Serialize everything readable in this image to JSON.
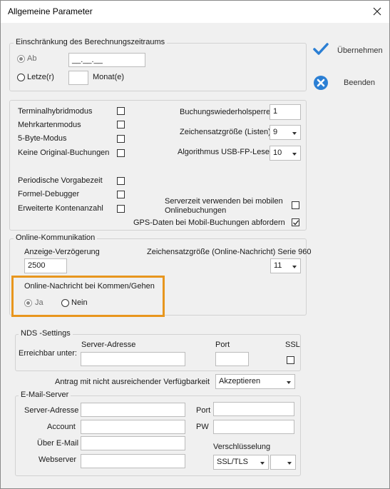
{
  "window": {
    "title": "Allgemeine Parameter"
  },
  "side_buttons": {
    "accept_label": "Übernehmen",
    "quit_label": "Beenden"
  },
  "period": {
    "legend": "Einschränkung des Berechnungszeitraums",
    "from_label": "Ab",
    "from_value": "__.__.__",
    "last_label": "Letze(r)",
    "last_value": "",
    "month_label": "Monat(e)"
  },
  "options": {
    "left_items": [
      {
        "label": "Terminalhybridmodus",
        "checked": false
      },
      {
        "label": "Mehrkartenmodus",
        "checked": false
      },
      {
        "label": "5-Byte-Modus",
        "checked": false
      },
      {
        "label": "Keine Original-Buchungen",
        "checked": false
      },
      {
        "label": "Periodische Vorgabezeit",
        "checked": false
      },
      {
        "label": "Formel-Debugger",
        "checked": false
      },
      {
        "label": "Erweiterte Kontenanzahl",
        "checked": false
      }
    ],
    "booking_repeat_label": "Buchungswiederholsperre",
    "booking_repeat_value": "1",
    "charsize_lists_label": "Zeichensatzgröße (Listen)",
    "charsize_lists_value": "9",
    "algorithm_label": "Algorithmus USB-FP-Leser",
    "algorithm_value": "10",
    "server_time_label_1": "Serverzeit verwenden bei mobilen",
    "server_time_label_2": "Onlinebuchungen",
    "server_time_checked": false,
    "gps_label": "GPS-Daten bei Mobil-Buchungen abfordern",
    "gps_checked": true
  },
  "online": {
    "legend": "Online-Kommunikation",
    "delay_label": "Anzeige-Verzögerung",
    "delay_value": "2500",
    "charsize_label": "Zeichensatzgröße (Online-Nachricht) Serie 960",
    "charsize_value": "11",
    "message_legend": "Online-Nachricht bei Kommen/Gehen",
    "yes_label": "Ja",
    "no_label": "Nein"
  },
  "nds": {
    "legend": "NDS -Settings",
    "reachable_label": "Erreichbar unter:",
    "server_label": "Server-Adresse",
    "server_value": "",
    "port_label": "Port",
    "port_value": "",
    "ssl_label": "SSL",
    "ssl_checked": false
  },
  "availability": {
    "label": "Antrag mit nicht ausreichender Verfügbarkeit",
    "value": "Akzeptieren"
  },
  "mail": {
    "legend": "E-Mail-Server",
    "server_label": "Server-Adresse",
    "server_value": "",
    "account_label": "Account",
    "account_value": "",
    "via_mail_label": "Über E-Mail",
    "via_mail_value": "",
    "webserver_label": "Webserver",
    "webserver_value": "",
    "port_label": "Port",
    "port_value": "",
    "pw_label": "PW",
    "pw_value": "",
    "encryption_label": "Verschlüsselung",
    "encryption_value": "SSL/TLS",
    "encryption_extra_value": ""
  },
  "colors": {
    "accept_icon": "#2b7fd4",
    "quit_icon": "#2b7fd4",
    "highlight": "#e8961e"
  }
}
